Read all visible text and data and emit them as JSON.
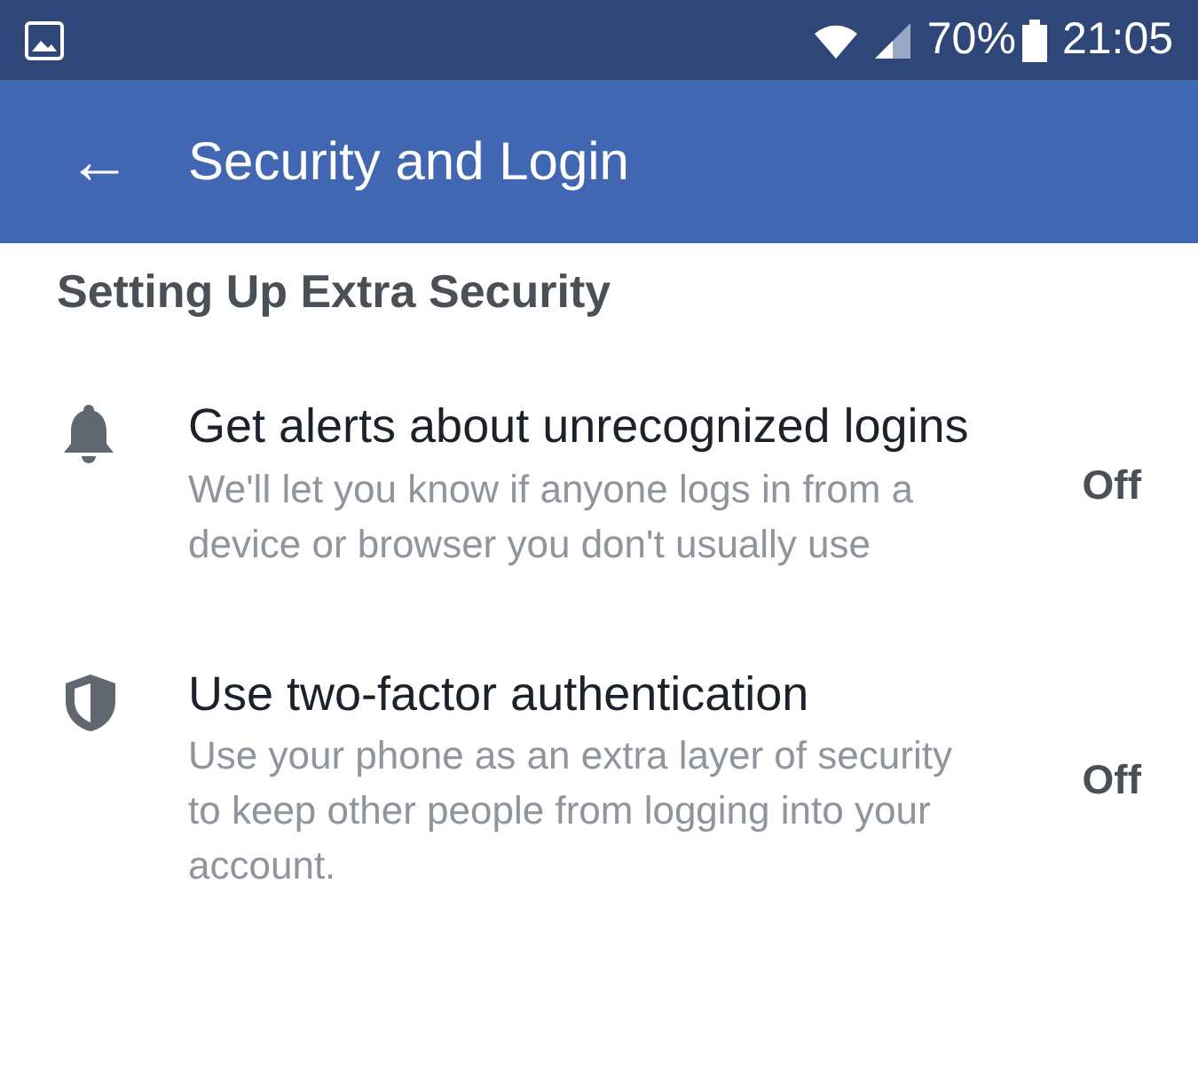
{
  "status_bar": {
    "battery": "70%",
    "time": "21:05"
  },
  "header": {
    "back": "←",
    "title": "Security and Login"
  },
  "section": {
    "title": "Setting Up Extra Security"
  },
  "settings": [
    {
      "kind": "bell",
      "title": "Get alerts about unrecognized logins",
      "description": "We'll let you know if anyone logs in from a device or browser you don't usually use",
      "value": "Off"
    },
    {
      "kind": "shield",
      "title": "Use two-factor authentication",
      "description": "Use your phone as an extra layer of security to keep other people from logging into your account.",
      "value": "Off"
    }
  ]
}
